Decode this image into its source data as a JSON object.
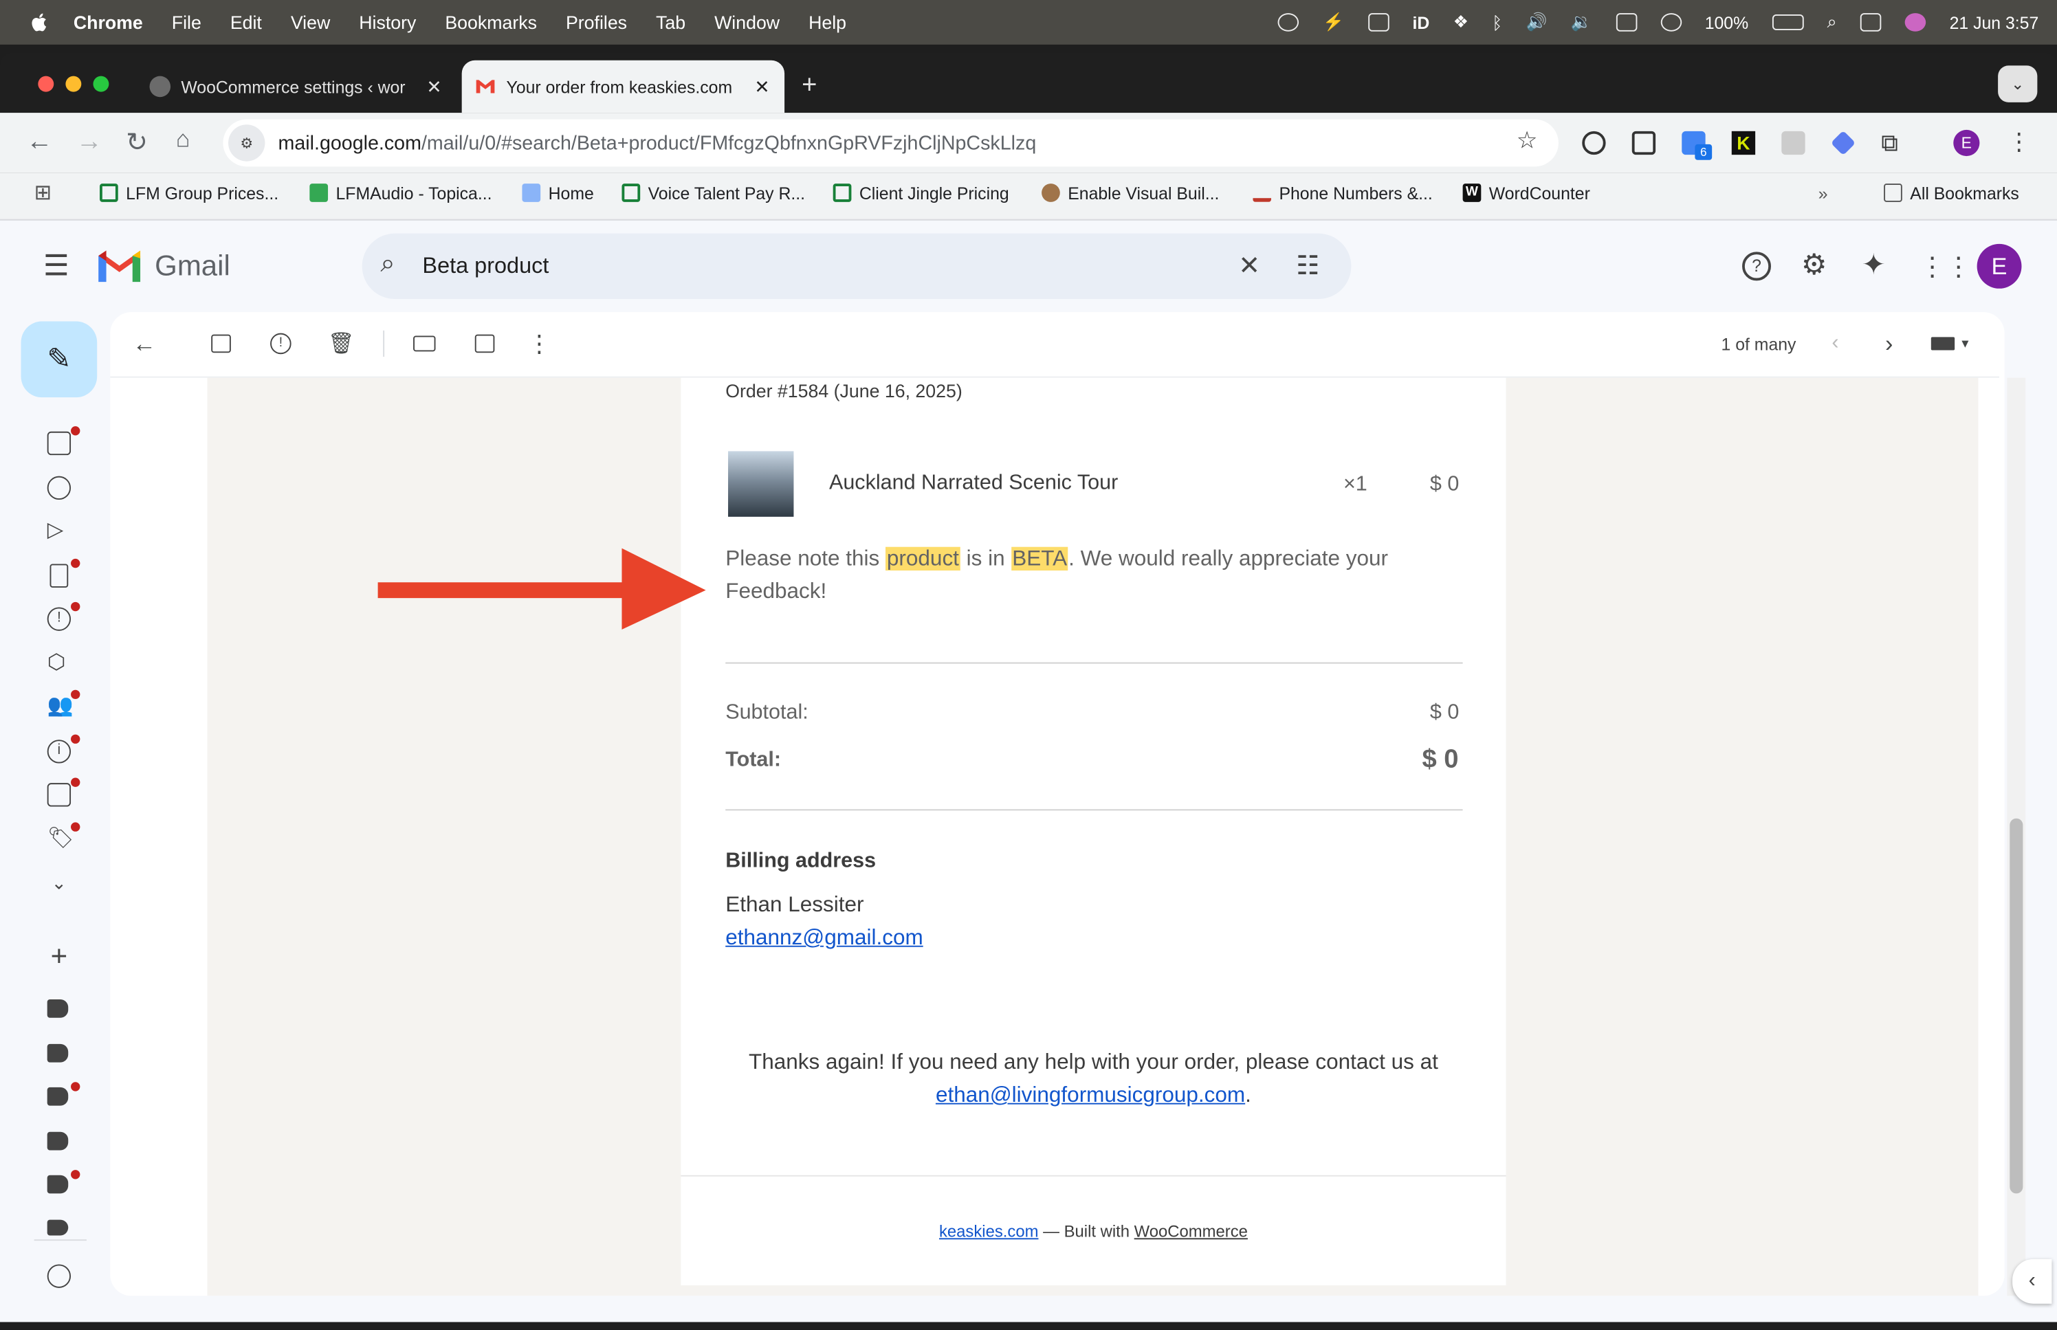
{
  "menubar": {
    "app": "Chrome",
    "items": [
      "File",
      "Edit",
      "View",
      "History",
      "Bookmarks",
      "Profiles",
      "Tab",
      "Window",
      "Help"
    ],
    "battery": "100%",
    "datetime": "21 Jun  3:57"
  },
  "tabs": [
    {
      "title": "WooCommerce settings ‹ wor"
    },
    {
      "title": "Your order from keaskies.com"
    }
  ],
  "address": {
    "host": "mail.google.com",
    "path": "/mail/u/0/#search/Beta+product/FMfcgzQbfnxnGpRVFzjhCljNpCskLlzq"
  },
  "extensions": {
    "badge": "6"
  },
  "profile_initial": "E",
  "bookmarks": [
    {
      "label": "LFM Group Prices..."
    },
    {
      "label": "LFMAudio - Topica..."
    },
    {
      "label": "Home"
    },
    {
      "label": "Voice Talent Pay R..."
    },
    {
      "label": "Client Jingle Pricing"
    },
    {
      "label": "Enable Visual Buil..."
    },
    {
      "label": "Phone Numbers &..."
    },
    {
      "label": "WordCounter"
    }
  ],
  "all_bookmarks": "All Bookmarks",
  "gmail": {
    "logo_text": "Gmail",
    "search_value": "Beta product",
    "pagination": "1 of many",
    "avatar_initial": "E"
  },
  "email": {
    "order_heading": "Order #1584 (June 16, 2025)",
    "item": {
      "name": "Auckland Narrated Scenic Tour",
      "qty": "×1",
      "price": "$ 0"
    },
    "note": {
      "pre": "Please note this ",
      "hl1": "product",
      "mid": " is in ",
      "hl2": "BETA",
      "post": ". We would really appreciate your Feedback!"
    },
    "subtotal_label": "Subtotal:",
    "subtotal_value": "$ 0",
    "total_label": "Total:",
    "total_value": "$ 0",
    "billing_heading": "Billing address",
    "billing_name": "Ethan Lessiter",
    "billing_email": "ethannz@gmail.com",
    "thanks_text": "Thanks again! If you need any help with your order, please contact us at",
    "contact_email": "ethan@livingformusicgroup.com",
    "contact_period": ".",
    "footer_site": "keaskies.com",
    "footer_sep": " — Built with ",
    "footer_platform": "WooCommerce"
  },
  "colors": {
    "accent_arrow": "#e8432a",
    "highlight": "#fddc6a",
    "link": "#1155cc",
    "compose_bg": "#c2e7ff",
    "avatar_bg": "#7b1fa2"
  }
}
